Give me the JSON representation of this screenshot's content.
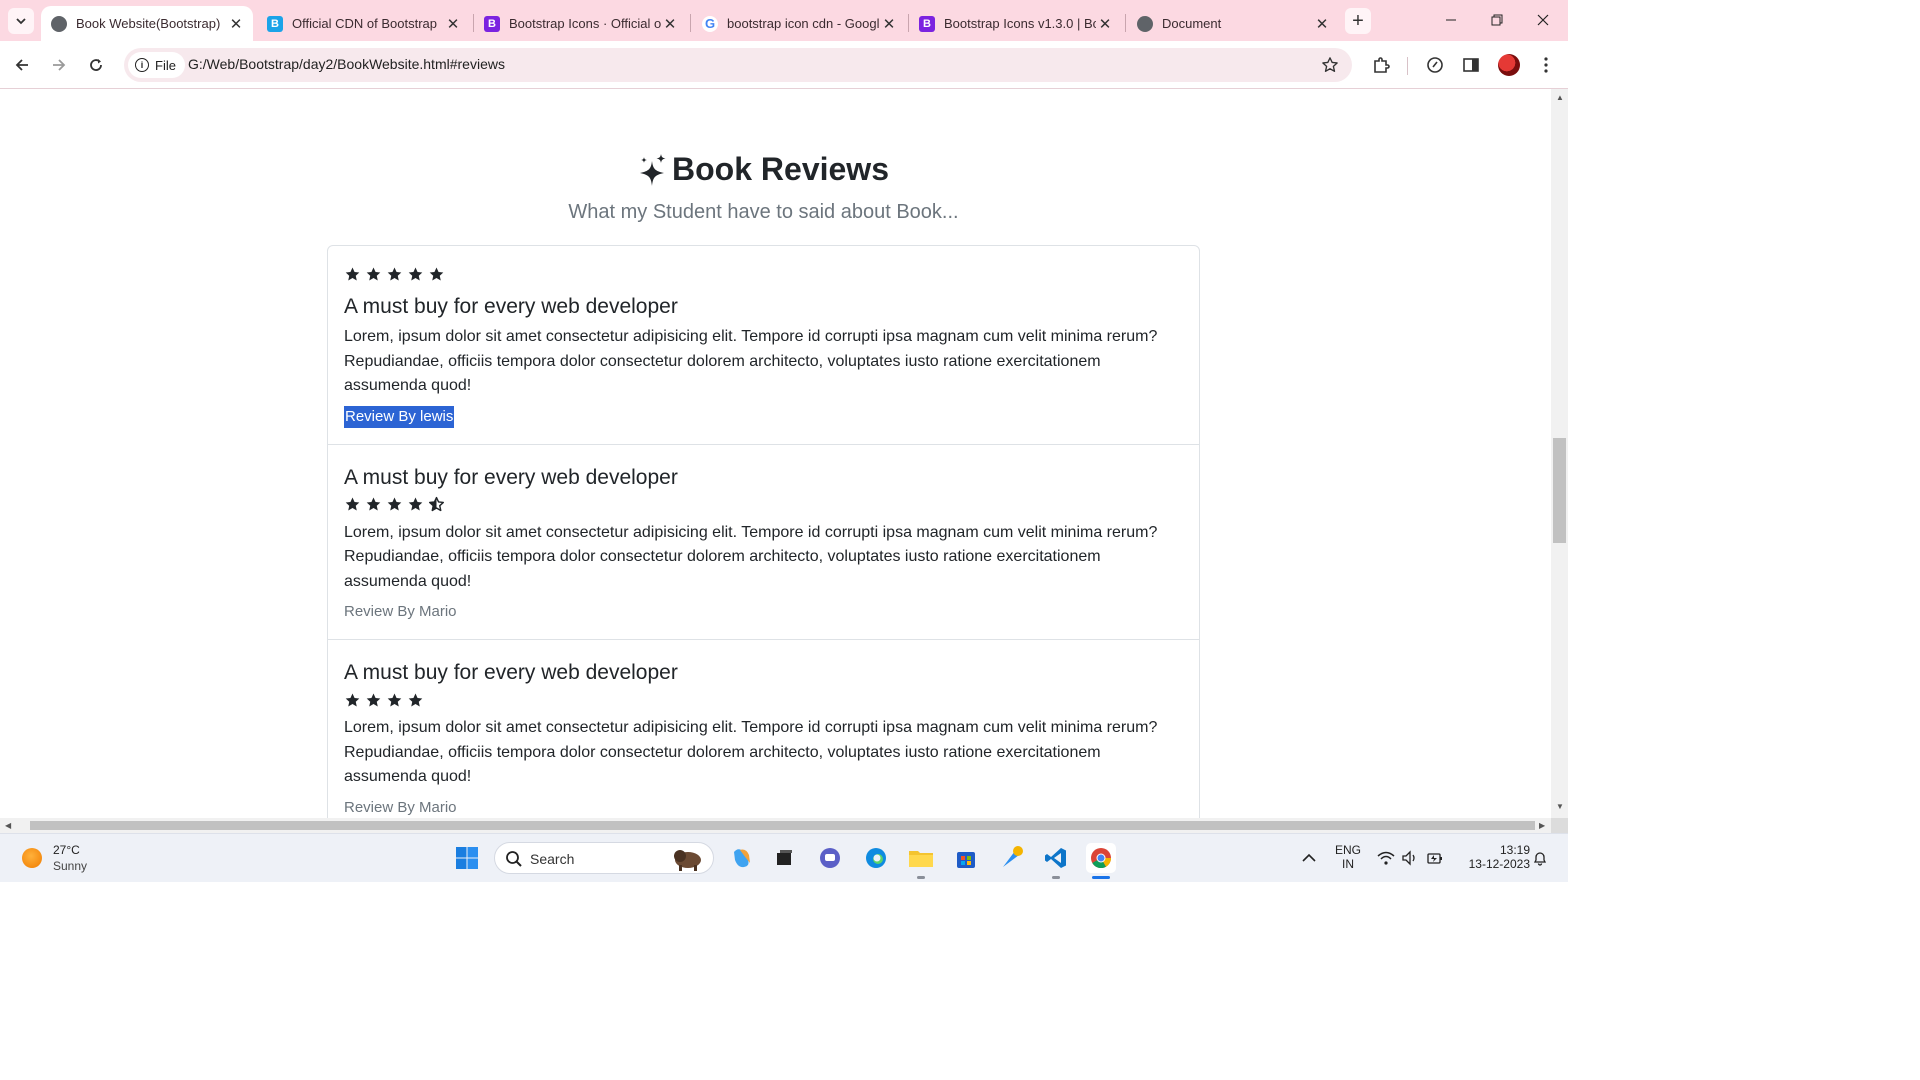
{
  "browser": {
    "tabs": [
      {
        "title": "Book Website(Bootstrap)",
        "active": true
      },
      {
        "title": "Official CDN of Bootstrap",
        "active": false
      },
      {
        "title": "Bootstrap Icons · Official open source SVG icon library",
        "active": false
      },
      {
        "title": "bootstrap icon cdn - Google Search",
        "active": false
      },
      {
        "title": "Bootstrap Icons v1.3.0 | Bootstrap Blog",
        "active": false
      },
      {
        "title": "Document",
        "active": false
      }
    ],
    "site_chip": "File",
    "url": "G:/Web/Bootstrap/day2/BookWebsite.html#reviews"
  },
  "page": {
    "section_title": "Book Reviews",
    "section_subtitle": "What my Student have to said about Book...",
    "reviews": [
      {
        "rating": 5,
        "title": "A must buy for every web developer",
        "body": "Lorem, ipsum dolor sit amet consectetur adipisicing elit. Tempore id corrupti ipsa magnam cum velit minima rerum? Repudiandae, officiis tempora dolor consectetur dolorem architecto, voluptates iusto ratione exercitationem assumenda quod!",
        "by": "Review By lewis"
      },
      {
        "rating": 4.5,
        "title": "A must buy for every web developer",
        "body": "Lorem, ipsum dolor sit amet consectetur adipisicing elit. Tempore id corrupti ipsa magnam cum velit minima rerum? Repudiandae, officiis tempora dolor consectetur dolorem architecto, voluptates iusto ratione exercitationem assumenda quod!",
        "by": "Review By Mario"
      },
      {
        "rating": 4,
        "title": "A must buy for every web developer",
        "body": "Lorem, ipsum dolor sit amet consectetur adipisicing elit. Tempore id corrupti ipsa magnam cum velit minima rerum? Repudiandae, officiis tempora dolor consectetur dolorem architecto, voluptates iusto ratione exercitationem assumenda quod!",
        "by": "Review By Mario"
      }
    ]
  },
  "taskbar": {
    "weather_temp": "27°C",
    "weather_condition": "Sunny",
    "search_label": "Search",
    "lang_line1": "ENG",
    "lang_line2": "IN",
    "time": "13:19",
    "date": "13-12-2023"
  },
  "colors": {
    "tab_strip": "#fcd9e2",
    "selection": "#2c64d4",
    "muted_text": "#6c757d"
  }
}
